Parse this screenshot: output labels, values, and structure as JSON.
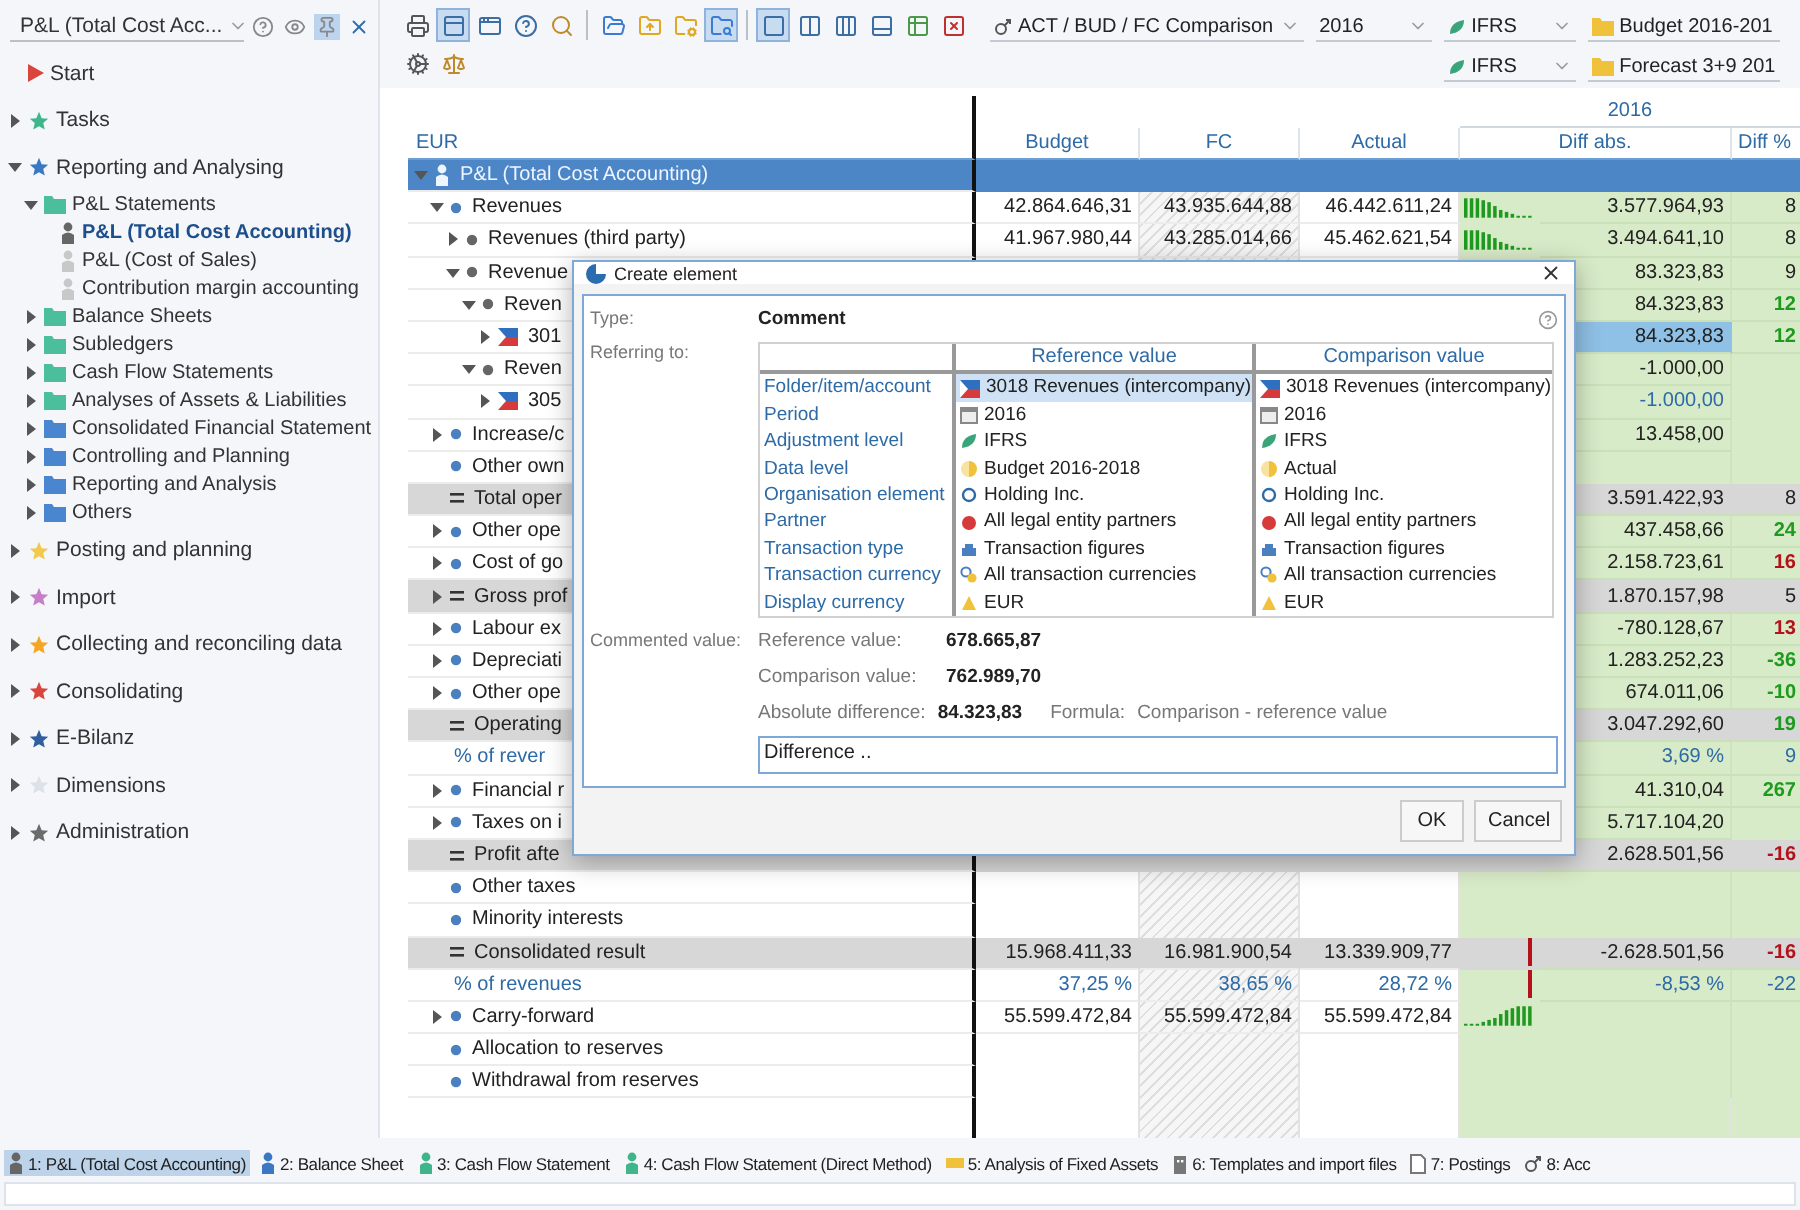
{
  "navigator": {
    "title": "P&L (Total Cost Acc...",
    "header_buttons": [
      {
        "selected": false
      },
      {
        "selected": false
      },
      {
        "selected": true
      },
      {
        "selected": false
      }
    ],
    "items": [
      {
        "label": "Start",
        "kind": "start",
        "color": "#d9453c"
      },
      {
        "label": "Tasks",
        "kind": "star",
        "color": "#3fb58c",
        "expanded": false
      },
      {
        "label": "Reporting and Analysing",
        "kind": "star",
        "color": "#3b78c4",
        "expanded": true,
        "children": [
          {
            "label": "P&L Statements",
            "kind": "folder",
            "color": "#4bbf9a",
            "expanded": true,
            "children": [
              {
                "label": "P&L (Total Cost Accounting)",
                "kind": "report",
                "selected": true
              },
              {
                "label": "P&L (Cost of Sales)",
                "kind": "report",
                "selected": false
              },
              {
                "label": "Contribution margin accounting",
                "kind": "report",
                "selected": false
              }
            ]
          },
          {
            "label": "Balance Sheets",
            "kind": "folder",
            "color": "#4bbf9a",
            "expanded": false
          },
          {
            "label": "Subledgers",
            "kind": "folder",
            "color": "#4bbf9a",
            "expanded": false
          },
          {
            "label": "Cash Flow Statements",
            "kind": "folder",
            "color": "#4bbf9a",
            "expanded": false
          },
          {
            "label": "Analyses of Assets & Liabilities",
            "kind": "folder",
            "color": "#4bbf9a",
            "expanded": false
          },
          {
            "label": "Consolidated Financial Statement",
            "kind": "folder",
            "color": "#4a86d0",
            "expanded": false
          },
          {
            "label": "Controlling and Planning",
            "kind": "folder",
            "color": "#4a86d0",
            "expanded": false
          },
          {
            "label": "Reporting and Analysis",
            "kind": "folder",
            "color": "#4a86d0",
            "expanded": false
          },
          {
            "label": "Others",
            "kind": "folder",
            "color": "#4a86d0",
            "expanded": false
          }
        ]
      },
      {
        "label": "Posting and planning",
        "kind": "star",
        "color": "#f2c94c",
        "expanded": false
      },
      {
        "label": "Import",
        "kind": "star",
        "color": "#c77ec9",
        "expanded": false
      },
      {
        "label": "Collecting and reconciling data",
        "kind": "star",
        "color": "#f5a623",
        "expanded": false
      },
      {
        "label": "Consolidating",
        "kind": "star",
        "color": "#d9453c",
        "expanded": false
      },
      {
        "label": "E-Bilanz",
        "kind": "star",
        "color": "#2f5f9e",
        "expanded": false
      },
      {
        "label": "Dimensions",
        "kind": "star",
        "color": "#dde2e8",
        "expanded": false
      },
      {
        "label": "Administration",
        "kind": "star",
        "color": "#6b6b6b",
        "expanded": false
      }
    ]
  },
  "toolbar": [
    {
      "selected": false
    },
    {
      "selected": true
    },
    {
      "selected": false
    },
    {
      "selected": false
    },
    {
      "selected": false
    },
    {
      "selected": false
    },
    {
      "selected": false
    },
    {
      "selected": false
    },
    {
      "selected": true
    },
    {
      "selected": true
    },
    {
      "selected": false
    },
    {
      "selected": false
    },
    {
      "selected": false
    },
    {
      "selected": false
    },
    {
      "selected": false
    }
  ],
  "toolbar_row2": [
    {
      "selected": false
    },
    {
      "selected": false
    }
  ],
  "selectors": [
    {
      "value": "ACT / BUD / FC Comparison",
      "kind": "comparison"
    },
    {
      "value": "2016",
      "kind": "plain"
    },
    {
      "value": "IFRS",
      "kind": "ifrs"
    },
    {
      "value": "Budget 2016-201",
      "kind": "data"
    }
  ],
  "selectors_row2": [
    {
      "value": "IFRS",
      "kind": "ifrs"
    },
    {
      "value": "Forecast 3+9 201",
      "kind": "data"
    }
  ],
  "table": {
    "year": "2016",
    "currency": "EUR",
    "columns": [
      "Budget",
      "FC",
      "Actual",
      "Diff abs.",
      "Diff %"
    ],
    "rows": [
      {
        "label": "P&L (Total Cost Accounting)",
        "kind": "report",
        "selected": true,
        "expanded": true,
        "children": [
          {
            "label": "Revenues",
            "kind": "bullet",
            "selected": false,
            "expanded": true,
            "budget": "42.864.646,31",
            "fc": "43.935.644,88",
            "actual": "46.442.611,24",
            "sparkline": {
              "kind": "falling"
            },
            "diff": "3.577.964,93",
            "pct": {
              "text": "8",
              "color": "#222222"
            },
            "children": [
              {
                "label": "Revenues (third party)",
                "kind": "bullet",
                "selected": false,
                "expanded": false,
                "budget": "41.967.980,44",
                "fc": "43.285.014,66",
                "actual": "45.462.621,54",
                "sparkline": {
                  "kind": "falling"
                },
                "diff": "3.494.641,10",
                "pct": {
                  "text": "8",
                  "color": "#222222"
                }
              },
              {
                "label": "Revenue",
                "kind": "bullet",
                "selected": false,
                "expanded": true,
                "diff": "83.323,83",
                "pct": {
                  "text": "9",
                  "color": "#222222"
                },
                "children": [
                  {
                    "label": "Reven",
                    "kind": "bullet",
                    "selected": false,
                    "expanded": true,
                    "diff": "84.323,83",
                    "pct": {
                      "text": "12",
                      "color": "#1f9a1f"
                    },
                    "children": [
                      {
                        "label": "301",
                        "kind": "flag",
                        "selected": false,
                        "expanded": false,
                        "diff": "84.323,83",
                        "diff_highlighted": true,
                        "pct": {
                          "text": "12",
                          "color": "#1f9a1f"
                        }
                      }
                    ]
                  },
                  {
                    "label": "Reven",
                    "kind": "bullet",
                    "selected": false,
                    "expanded": true,
                    "diff": "-1.000,00",
                    "children": [
                      {
                        "label": "305",
                        "kind": "flag",
                        "selected": false,
                        "expanded": false,
                        "diff": {
                          "text": "-1.000,00",
                          "color": "#2d6aa6"
                        }
                      }
                    ]
                  }
                ]
              }
            ]
          },
          {
            "label": "Increase/c",
            "kind": "bullet",
            "selected": false,
            "expanded": false,
            "diff": "13.458,00"
          },
          {
            "label": "Other own",
            "kind": "bullet",
            "selected": false
          },
          {
            "label": "Total oper",
            "kind": "sum",
            "selected": false,
            "diff": "3.591.422,93",
            "pct": {
              "text": "8",
              "color": "#222222"
            }
          },
          {
            "label": "Other ope",
            "kind": "bullet",
            "selected": false,
            "expanded": false,
            "diff": "437.458,66",
            "pct": {
              "text": "24",
              "color": "#1f9a1f"
            }
          },
          {
            "label": "Cost of go",
            "kind": "bullet",
            "selected": false,
            "expanded": false,
            "diff": "2.158.723,61",
            "pct": {
              "text": "16",
              "color": "#b3121b"
            }
          },
          {
            "label": "Gross prof",
            "kind": "sum",
            "selected": false,
            "expanded": false,
            "diff": "1.870.157,98",
            "pct": {
              "text": "5",
              "color": "#222222"
            }
          },
          {
            "label": "Labour ex",
            "kind": "bullet",
            "selected": false,
            "expanded": false,
            "diff": "-780.128,67",
            "pct": {
              "text": "13",
              "color": "#b3121b"
            }
          },
          {
            "label": "Depreciati",
            "kind": "bullet",
            "selected": false,
            "expanded": false,
            "diff": "1.283.252,23",
            "pct": {
              "text": "-36",
              "color": "#1f9a1f"
            }
          },
          {
            "label": "Other ope",
            "kind": "bullet",
            "selected": false,
            "expanded": false,
            "diff": "674.011,06",
            "pct": {
              "text": "-10",
              "color": "#1f9a1f"
            }
          },
          {
            "label": "Operating",
            "kind": "sum",
            "selected": false,
            "diff": "3.047.292,60",
            "pct": {
              "text": "19",
              "color": "#1f9a1f"
            }
          },
          {
            "label": "% of rever",
            "kind": "percent",
            "selected": false,
            "diff": "3,69 %",
            "pct": {
              "text": "9",
              "color": "#2d6aa6"
            }
          },
          {
            "label": "Financial r",
            "kind": "bullet",
            "selected": false,
            "expanded": false,
            "diff": "41.310,04",
            "pct": {
              "text": "267",
              "color": "#1f9a1f"
            }
          },
          {
            "label": "Taxes on i",
            "kind": "bullet",
            "selected": false,
            "expanded": false,
            "diff": "5.717.104,20"
          },
          {
            "label": "Profit afte",
            "kind": "sum",
            "selected": false,
            "diff": "2.628.501,56",
            "pct": {
              "text": "-16",
              "color": "#b3121b"
            }
          },
          {
            "label": "Other taxes",
            "kind": "bullet",
            "selected": false
          },
          {
            "label": "Minority interests",
            "kind": "bullet",
            "selected": false
          },
          {
            "label": "Consolidated result",
            "kind": "sum",
            "selected": false,
            "budget": "15.968.411,33",
            "fc": "16.981.900,54",
            "actual": "13.339.909,77",
            "sparkline": {
              "kind": "negative"
            },
            "diff": "-2.628.501,56",
            "pct": {
              "text": "-16",
              "color": "#b3121b"
            }
          },
          {
            "label": "% of revenues",
            "kind": "percent",
            "selected": false,
            "budget": "37,25 %",
            "fc": "38,65 %",
            "actual": "28,72 %",
            "sparkline": {
              "kind": "negative"
            },
            "diff": "-8,53 %",
            "pct": {
              "text": "-22",
              "color": "#2d6aa6"
            }
          },
          {
            "label": "Carry-forward",
            "kind": "bullet",
            "selected": false,
            "expanded": false,
            "budget": "55.599.472,84",
            "fc": "55.599.472,84",
            "actual": "55.599.472,84",
            "sparkline": {
              "kind": "rising"
            }
          },
          {
            "label": "Allocation to reserves",
            "kind": "bullet",
            "selected": false
          },
          {
            "label": "Withdrawal from reserves",
            "kind": "bullet",
            "selected": false
          }
        ]
      }
    ]
  },
  "dialog": {
    "title": "Create element",
    "type_label": "Type:",
    "type_value": "Comment",
    "referring_label": "Referring to:",
    "ref_header": "Reference value",
    "cmp_header": "Comparison value",
    "rows": [
      {
        "label": "Folder/item/account",
        "kind": "account",
        "reference": "3018 Revenues (intercompany)",
        "comparison": "3018 Revenues (intercompany)",
        "selected": true
      },
      {
        "label": "Period",
        "kind": "period",
        "reference": "2016",
        "comparison": "2016",
        "selected": false
      },
      {
        "label": "Adjustment level",
        "kind": "adjustment",
        "reference": "IFRS",
        "comparison": "IFRS",
        "selected": false
      },
      {
        "label": "Data level",
        "kind": "data",
        "reference": "Budget 2016-2018",
        "comparison": "Actual",
        "selected": false
      },
      {
        "label": "Organisation element",
        "kind": "organisation",
        "reference": "Holding Inc.",
        "comparison": "Holding Inc.",
        "selected": false
      },
      {
        "label": "Partner",
        "kind": "partner",
        "reference": "All legal entity partners",
        "comparison": "All legal entity partners",
        "selected": false
      },
      {
        "label": "Transaction type",
        "kind": "transaction",
        "reference": "Transaction figures",
        "comparison": "Transaction figures",
        "selected": false
      },
      {
        "label": "Transaction currency",
        "kind": "currency",
        "reference": "All transaction currencies",
        "comparison": "All transaction currencies",
        "selected": false
      },
      {
        "label": "Display currency",
        "kind": "display",
        "reference": "EUR",
        "comparison": "EUR",
        "selected": false
      }
    ],
    "commented_label": "Commented value:",
    "values": [
      {
        "label": "Reference value:",
        "value": "678.665,87"
      },
      {
        "label": "Comparison value:",
        "value": "762.989,70"
      },
      {
        "label": "Absolute difference:",
        "value": "84.323,83"
      }
    ],
    "formula_label": "Formula:",
    "formula": "Comparison - reference value",
    "comment": "Difference ..",
    "buttons": [
      "OK",
      "Cancel"
    ]
  },
  "document_tabs": [
    {
      "label": "1: P&L (Total Cost Accounting)",
      "kind": "report",
      "selected": true
    },
    {
      "label": "2: Balance Sheet",
      "kind": "balance",
      "selected": false
    },
    {
      "label": "3: Cash Flow Statement",
      "kind": "cashflow",
      "selected": false
    },
    {
      "label": "4: Cash Flow Statement (Direct Method)",
      "kind": "cashflow",
      "selected": false
    },
    {
      "label": "5: Analysis of Fixed Assets",
      "kind": "assets",
      "selected": false
    },
    {
      "label": "6: Templates and import files",
      "kind": "templates",
      "selected": false
    },
    {
      "label": "7: Postings",
      "kind": "postings",
      "selected": false
    },
    {
      "label": "8: Acc",
      "kind": "comparison",
      "selected": false
    }
  ]
}
